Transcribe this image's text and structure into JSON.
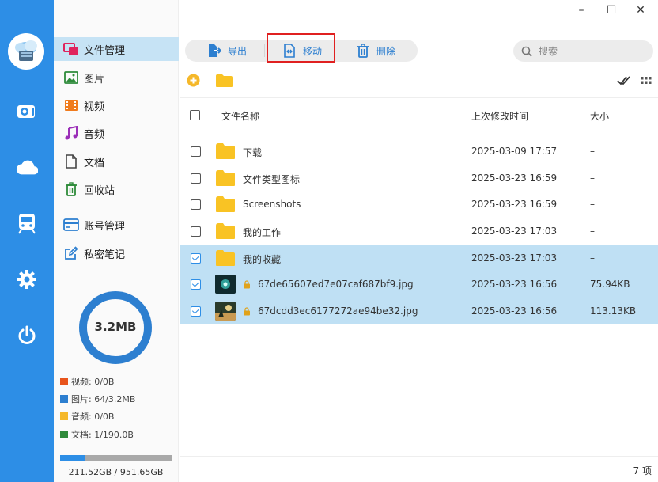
{
  "window": {
    "minimize_glyph": "–",
    "maximize_glyph": "☐",
    "close_glyph": "✕"
  },
  "colors": {
    "accent": "#2d8ee6",
    "selected_row": "#bfe0f4",
    "folder": "#f9c324",
    "highlight_border": "#e02020"
  },
  "rail": {
    "icons": [
      "camera-icon",
      "cloud-icon",
      "train-icon",
      "gear-icon",
      "power-icon"
    ]
  },
  "sidebar": {
    "items": [
      {
        "label": "文件管理",
        "icon": "file-manager-icon"
      },
      {
        "label": "图片",
        "icon": "image-icon"
      },
      {
        "label": "视频",
        "icon": "video-icon"
      },
      {
        "label": "音频",
        "icon": "music-icon"
      },
      {
        "label": "文档",
        "icon": "document-icon"
      },
      {
        "label": "回收站",
        "icon": "trash-icon"
      },
      {
        "label": "账号管理",
        "icon": "account-card-icon"
      },
      {
        "label": "私密笔记",
        "icon": "note-edit-icon"
      }
    ],
    "storage_used": "3.2MB",
    "legend": [
      {
        "label": "视频: 0/0B",
        "color": "#e8541c"
      },
      {
        "label": "图片: 64/3.2MB",
        "color": "#2d7fd0"
      },
      {
        "label": "音频: 0/0B",
        "color": "#f5b82a"
      },
      {
        "label": "文档: 1/190.0B",
        "color": "#2f8a3a"
      }
    ],
    "disk_usage_fraction": 0.22,
    "disk_text": "211.52GB / 951.65GB"
  },
  "toolbar": {
    "export_label": "导出",
    "move_label": "移动",
    "delete_label": "删除"
  },
  "search": {
    "placeholder": "搜索"
  },
  "table": {
    "columns": {
      "name": "文件名称",
      "modified": "上次修改时间",
      "size": "大小"
    },
    "rows": [
      {
        "name": "下载",
        "date": "2025-03-09 17:57",
        "size": "–",
        "type": "folder",
        "selected": false
      },
      {
        "name": "文件类型图标",
        "date": "2025-03-23 16:59",
        "size": "–",
        "type": "folder",
        "selected": false
      },
      {
        "name": "Screenshots",
        "date": "2025-03-23 16:59",
        "size": "–",
        "type": "folder",
        "selected": false
      },
      {
        "name": "我的工作",
        "date": "2025-03-23 17:03",
        "size": "–",
        "type": "folder",
        "selected": false
      },
      {
        "name": "我的收藏",
        "date": "2025-03-23 17:03",
        "size": "–",
        "type": "folder",
        "selected": true
      },
      {
        "name": "67de65607ed7e07caf687bf9.jpg",
        "date": "2025-03-23 16:56",
        "size": "75.94KB",
        "type": "image",
        "selected": true
      },
      {
        "name": "67dcdd3ec6177272ae94be32.jpg",
        "date": "2025-03-23 16:56",
        "size": "113.13KB",
        "type": "image",
        "selected": true
      }
    ]
  },
  "status": {
    "count": "7 项"
  }
}
